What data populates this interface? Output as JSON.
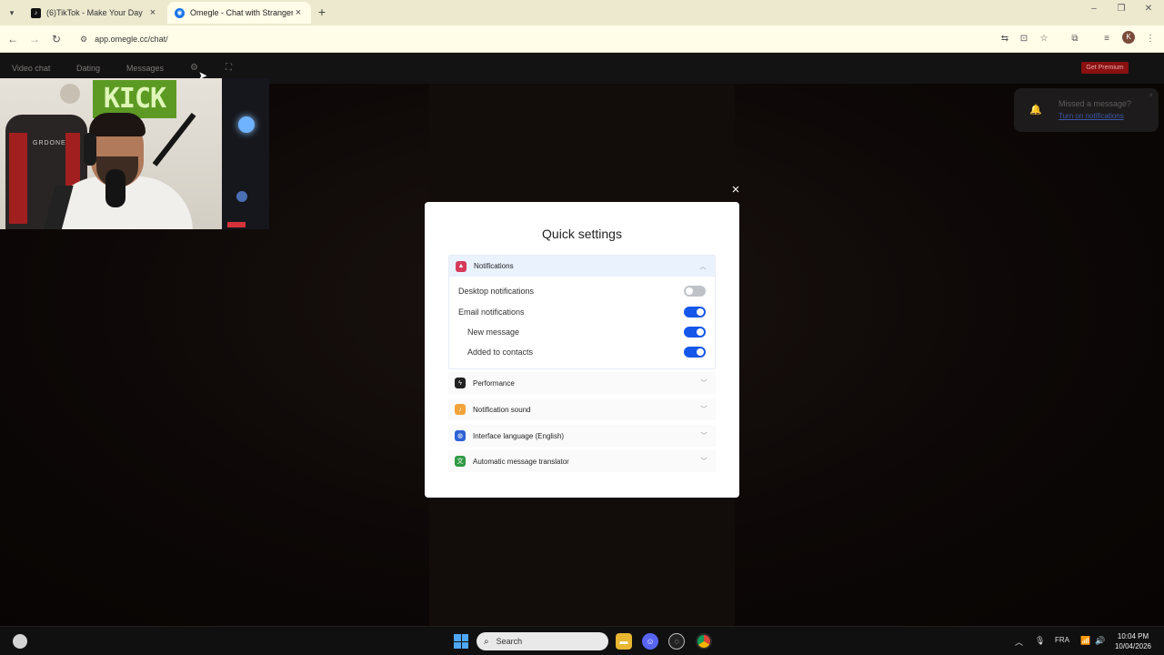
{
  "browser": {
    "tabs": [
      {
        "label": "(6)TikTok - Make Your Day",
        "active": false
      },
      {
        "label": "Omegle - Chat with Strangers",
        "active": true
      }
    ],
    "url": "app.omegle.cc/chat/",
    "profile_initial": "K"
  },
  "sitenav": {
    "links": [
      "Video chat",
      "Dating",
      "Messages"
    ],
    "premium_label": "Get Premium"
  },
  "webcam": {
    "sign_text": "KICK",
    "chair_text": "GRDONE"
  },
  "toast": {
    "title": "Missed a message?",
    "link": "Turn on notifications"
  },
  "modal": {
    "close": "×",
    "title": "Quick settings",
    "open_section": {
      "title": "Notifications",
      "items": [
        {
          "label": "Desktop notifications",
          "enabled": false
        },
        {
          "label": "Email notifications",
          "enabled": true
        },
        {
          "label": "New message",
          "enabled": true
        },
        {
          "label": "Added to contacts",
          "enabled": true
        }
      ]
    },
    "sections": [
      {
        "title": "Performance",
        "icon": "lightning-icon"
      },
      {
        "title": "Notification sound",
        "icon": "speaker-icon"
      },
      {
        "title": "Interface language (English)",
        "icon": "globe-icon"
      },
      {
        "title": "Automatic message translator",
        "icon": "translate-icon"
      }
    ]
  },
  "taskbar": {
    "search_placeholder": "Search",
    "language": "FRA",
    "time": "10:04 PM",
    "date": "10/04/2026"
  }
}
